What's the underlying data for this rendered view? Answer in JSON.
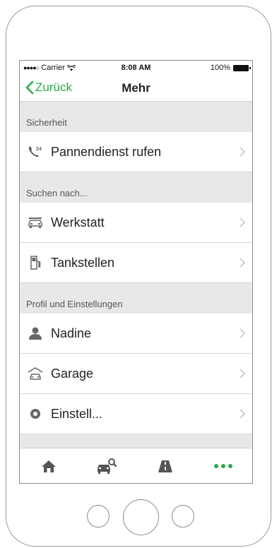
{
  "status_bar": {
    "carrier": "Carrier",
    "time": "8:08 AM",
    "battery": "100%"
  },
  "navbar": {
    "back_label": "Zurück",
    "title": "Mehr"
  },
  "sections": [
    {
      "header": "Sicherheit",
      "items": [
        {
          "label": "Pannendienst rufen",
          "icon": "phone-24-icon"
        }
      ]
    },
    {
      "header": "Suchen nach...",
      "items": [
        {
          "label": "Werkstatt",
          "icon": "workshop-car-icon"
        },
        {
          "label": "Tankstellen",
          "icon": "fuel-pump-icon"
        }
      ]
    },
    {
      "header": "Profil und Einstellungen",
      "items": [
        {
          "label": "Nadine",
          "icon": "user-icon"
        },
        {
          "label": "Garage",
          "icon": "garage-icon"
        },
        {
          "label": "Einstell...",
          "icon": "settings-icon"
        }
      ]
    }
  ],
  "tabbar": {
    "tabs": [
      "home-icon",
      "car-search-icon",
      "road-icon",
      "more-dots-icon"
    ],
    "active_tab": "more-dots-icon"
  },
  "colors": {
    "accent": "#2aa84a",
    "icon_gray": "#555555",
    "chevron": "#bdbdbd",
    "section_bg": "#e8e8e8"
  }
}
